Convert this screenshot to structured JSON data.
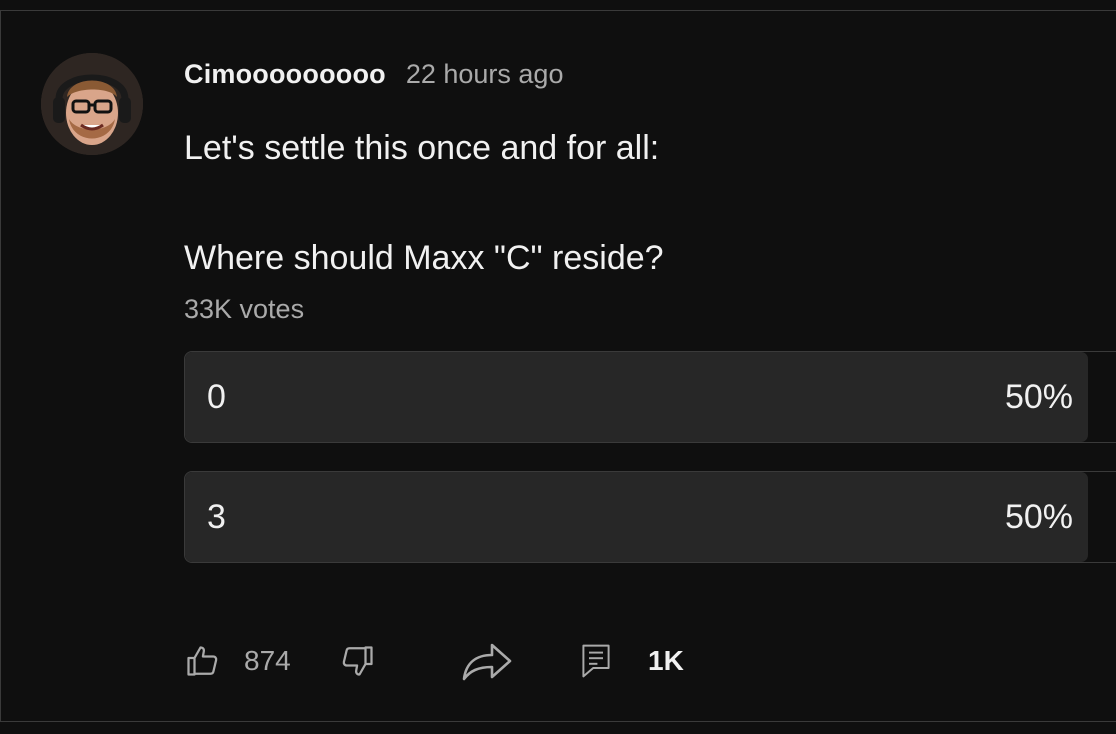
{
  "post": {
    "author": "Cimooooooooo",
    "time": "22 hours ago",
    "text": "Let's settle this once and for all:\n\nWhere should Maxx \"C\" reside?",
    "votes_label": "33K votes"
  },
  "poll": {
    "options": [
      {
        "label": "0",
        "percent_label": "50%",
        "fill_fraction": 0.5
      },
      {
        "label": "3",
        "percent_label": "50%",
        "fill_fraction": 0.5
      }
    ]
  },
  "actions": {
    "like_count": "874",
    "comment_count": "1K"
  },
  "icons": {
    "like": "thumbs-up-icon",
    "dislike": "thumbs-down-icon",
    "share": "share-icon",
    "comment": "comment-icon"
  },
  "colors": {
    "background": "#0f0f0f",
    "poll_bar": "#272727",
    "text": "#f1f1f1",
    "muted_text": "#aaaaaa"
  }
}
